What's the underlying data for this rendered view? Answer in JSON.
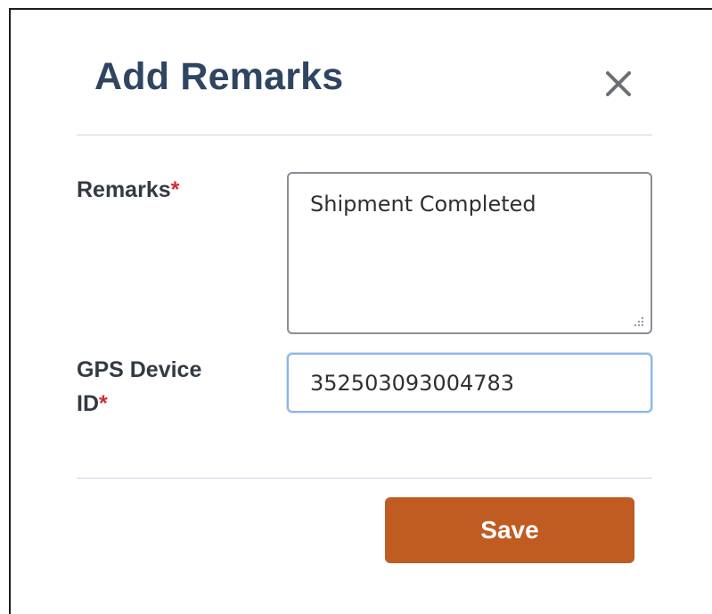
{
  "modal": {
    "title": "Add Remarks",
    "close_icon": "close-icon"
  },
  "form": {
    "remarks": {
      "label": "Remarks",
      "required_mark": "*",
      "value": "Shipment Completed"
    },
    "gps_device_id": {
      "label_line1": "GPS Device",
      "label_line2": "ID",
      "required_mark": "*",
      "value": "352503093004783"
    }
  },
  "footer": {
    "save_label": "Save"
  },
  "colors": {
    "title": "#2f4561",
    "required": "#d32b2b",
    "save_button": "#c05b22",
    "input_focus_border": "#8cb6e6"
  }
}
